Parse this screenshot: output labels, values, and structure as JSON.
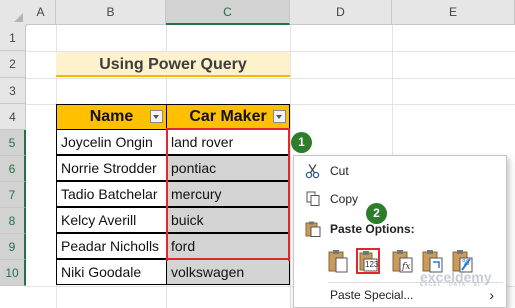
{
  "columns": [
    "A",
    "B",
    "C",
    "D",
    "E"
  ],
  "rows": [
    "1",
    "2",
    "3",
    "4",
    "5",
    "6",
    "7",
    "8",
    "9",
    "10"
  ],
  "title": "Using Power Query",
  "table": {
    "headers": [
      "Name",
      "Car Maker"
    ],
    "rows": [
      [
        "Joycelin Ongin",
        "land rover"
      ],
      [
        "Norrie Strodder",
        "pontiac"
      ],
      [
        "Tadio Batchelar",
        "mercury"
      ],
      [
        "Kelcy Averill",
        "buick"
      ],
      [
        "Peadar Nicholls",
        "ford"
      ],
      [
        "Niki Goodale",
        "volkswagen"
      ]
    ]
  },
  "badges": [
    "1",
    "2"
  ],
  "context_menu": {
    "cut": "Cut",
    "copy": "Copy",
    "paste_options": "Paste Options:",
    "paste_values_icon_text": "123",
    "paste_special": "Paste Special...",
    "submenu_arrow": "›"
  },
  "watermark": {
    "name": "exceldemy",
    "tagline": "EXCEL · DATA · BI"
  },
  "colors": {
    "header_fill": "#ffc000",
    "title_fill": "#fdf2cc",
    "highlight_red": "#e0292f",
    "badge_green": "#2d7d2d",
    "selection_gray": "#d4d4d4"
  }
}
